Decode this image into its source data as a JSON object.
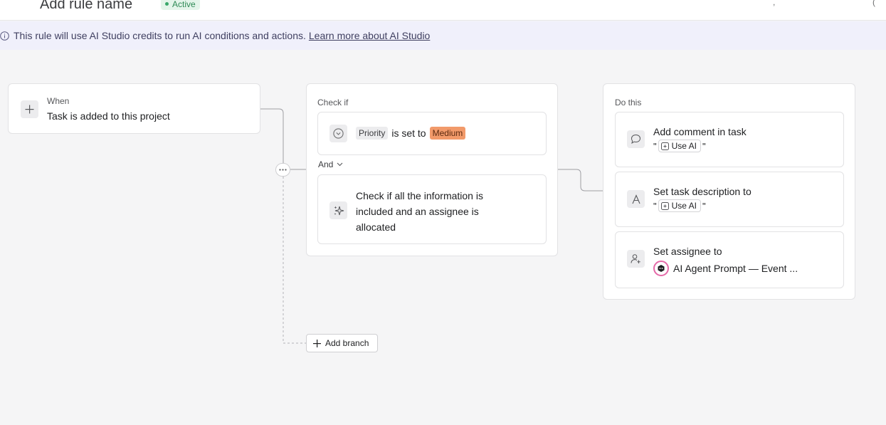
{
  "header": {
    "rule_name": "Add rule name",
    "status": "Active",
    "right_glyphs": [
      ",",
      "("
    ]
  },
  "banner": {
    "text": "This rule will use AI Studio credits to run AI conditions and actions.",
    "link": "Learn more about AI Studio"
  },
  "trigger": {
    "label": "When",
    "text": "Task is added to this project"
  },
  "conditions": {
    "label": "Check if",
    "condition1": {
      "field": "Priority",
      "operator": "is set to",
      "value": "Medium"
    },
    "joiner": "And",
    "condition2": {
      "text": "Check if all the information is included and an assignee is allocated"
    }
  },
  "actions": {
    "label": "Do this",
    "items": [
      {
        "title": "Add comment in task",
        "open_quote": "\"",
        "ai_label": "Use AI",
        "close_quote": "\""
      },
      {
        "title": "Set task description to",
        "open_quote": "\"",
        "ai_label": "Use AI",
        "close_quote": "\""
      },
      {
        "title": "Set assignee to",
        "assignee": "AI Agent Prompt — Event ..."
      }
    ]
  },
  "controls": {
    "add_branch": "Add branch",
    "more": "⋯"
  },
  "colors": {
    "medium_tag": "#f29a6a",
    "status_green": "#3aa86a",
    "banner_bg": "#f0f0fb",
    "agent_ring": "#e56aa8"
  }
}
